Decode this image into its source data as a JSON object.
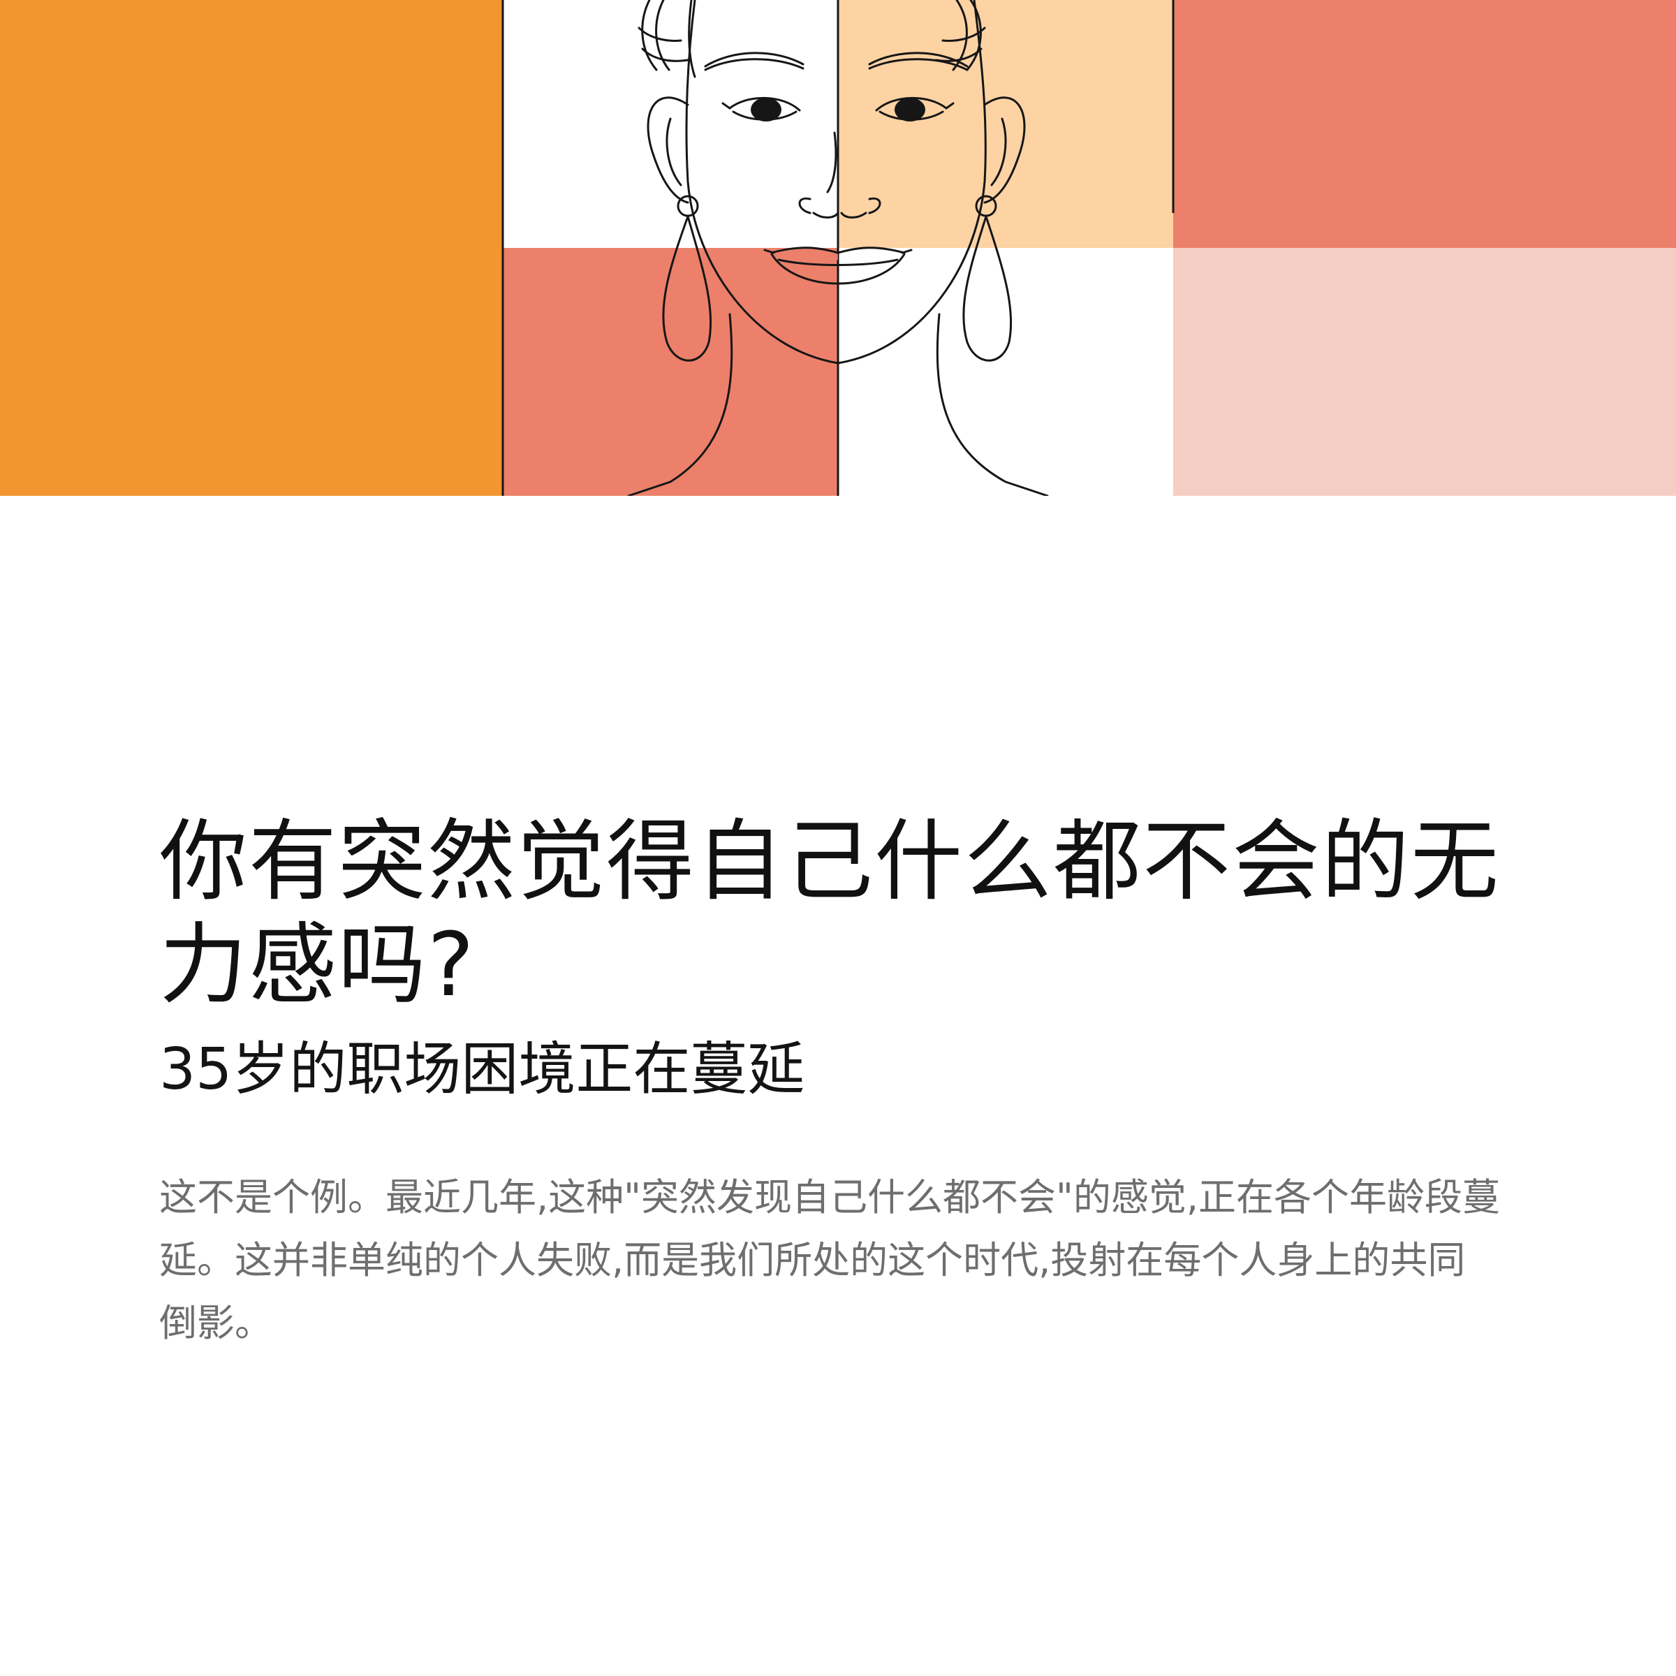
{
  "hero": {
    "colors": {
      "orange": "#F2962F",
      "coral": "#EC806A",
      "peach": "#FDD3A4",
      "blush": "#F5CEC3",
      "white": "#FFFFFF",
      "line": "#161616"
    },
    "illustration_icon": "woman-face-line-art"
  },
  "content": {
    "title": "你有突然觉得自己什么都不会的无力感吗?",
    "subtitle": "35岁的职场困境正在蔓延",
    "body": "这不是个例。最近几年,这种\"突然发现自己什么都不会\"的感觉,正在各个年龄段蔓延。这并非单纯的个人失败,而是我们所处的这个时代,投射在每个人身上的共同倒影。"
  }
}
